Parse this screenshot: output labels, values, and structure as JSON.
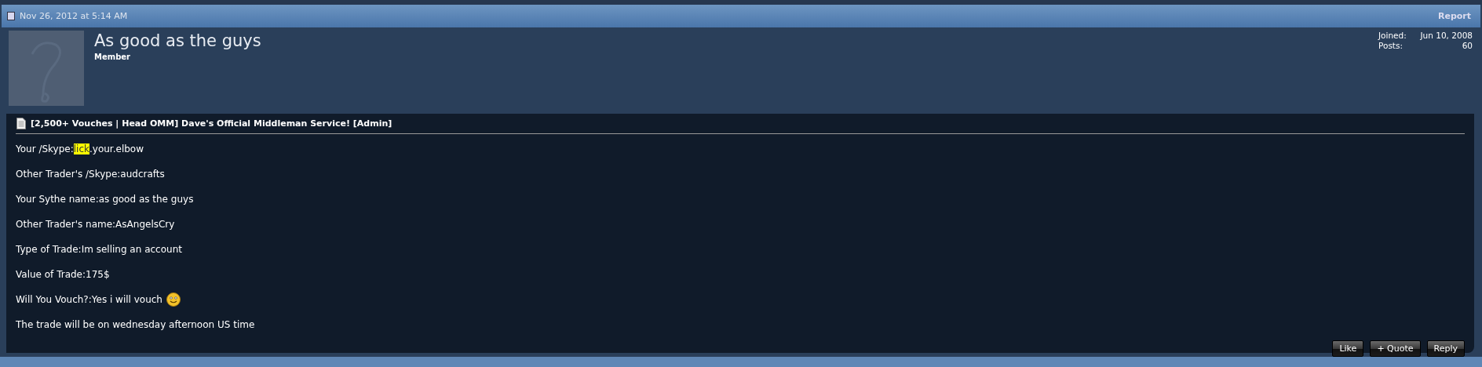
{
  "post_header": {
    "date": "Nov 26, 2012 at 5:14 AM",
    "report": "Report"
  },
  "user": {
    "name": "As good as the guys",
    "rank": "Member",
    "stats": [
      {
        "label": "Joined:",
        "value": "Jun 10, 2008"
      },
      {
        "label": "Posts:",
        "value": "60"
      }
    ]
  },
  "post": {
    "title": "[2,500+ Vouches | Head OMM] Dave's Official Middleman Service! [Admin]",
    "lines": [
      {
        "parts": [
          {
            "text": "Your /Skype:",
            "highlighted": false
          },
          {
            "text": "lick",
            "highlighted": true
          },
          {
            "text": ".your.elbow",
            "highlighted": false
          }
        ],
        "smiley": false
      },
      {
        "parts": [
          {
            "text": "Other Trader's /Skype:audcrafts",
            "highlighted": false
          }
        ],
        "smiley": false
      },
      {
        "parts": [
          {
            "text": "Your Sythe name:as good as the guys",
            "highlighted": false
          }
        ],
        "smiley": false
      },
      {
        "parts": [
          {
            "text": "Other Trader's name:AsAngelsCry",
            "highlighted": false
          }
        ],
        "smiley": false
      },
      {
        "parts": [
          {
            "text": "Type of Trade:Im selling an account",
            "highlighted": false
          }
        ],
        "smiley": false
      },
      {
        "parts": [
          {
            "text": "Value of Trade:175$",
            "highlighted": false
          }
        ],
        "smiley": false
      },
      {
        "parts": [
          {
            "text": "Will You Vouch?:Yes i will vouch",
            "highlighted": false
          }
        ],
        "smiley": true
      },
      {
        "parts": [
          {
            "text": "The trade will be on wednesday afternoon US time",
            "highlighted": false
          }
        ],
        "smiley": false
      }
    ],
    "buttons": [
      "Like",
      "+ Quote",
      "Reply"
    ]
  }
}
